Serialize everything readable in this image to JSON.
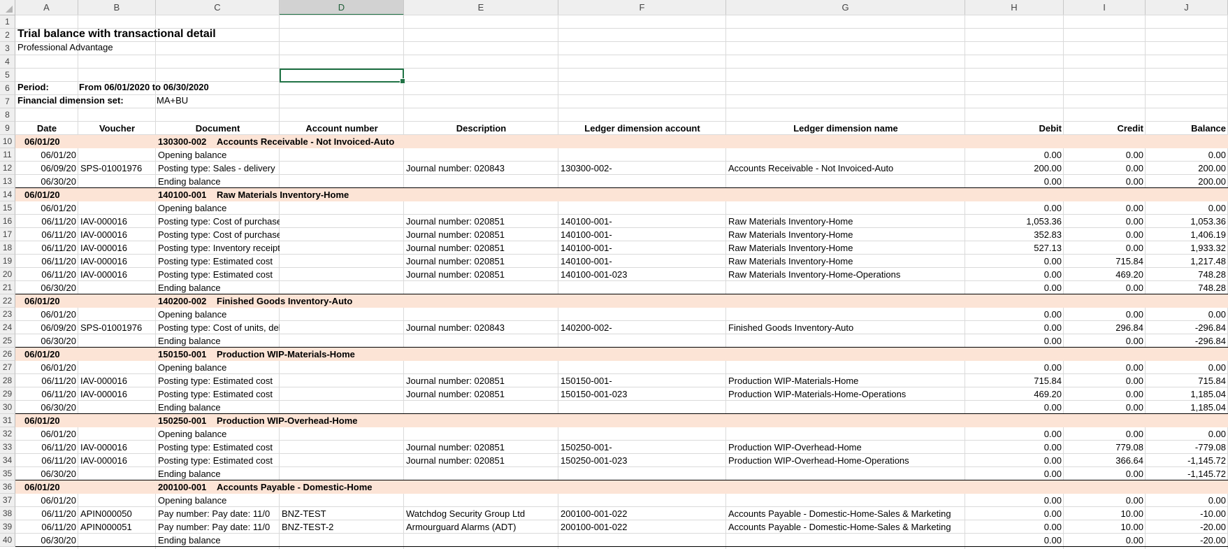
{
  "columns": [
    "A",
    "B",
    "C",
    "D",
    "E",
    "F",
    "G",
    "H",
    "I",
    "J"
  ],
  "selected_column": "D",
  "selected_cell": "D5",
  "report": {
    "title": "Trial balance with transactional detail",
    "company": "Professional Advantage",
    "period_label": "Period:",
    "period_value": "From 06/01/2020 to 06/30/2020",
    "dimension_label": "Financial dimension set:",
    "dimension_value": "MA+BU"
  },
  "headers": [
    "Date",
    "Voucher",
    "Document",
    "Account number",
    "Description",
    "Ledger dimension account",
    "Ledger dimension name",
    "Debit",
    "Credit",
    "Balance"
  ],
  "table_rows": [
    {
      "row": 10,
      "type": "group",
      "date": "06/01/20",
      "account": "130300-002",
      "name": "Accounts Receivable - Not Invoiced-Auto"
    },
    {
      "row": 11,
      "type": "detail",
      "date": "06/01/20",
      "voucher": "",
      "document": "Opening balance",
      "account": "",
      "description": "",
      "ledger_account": "",
      "ledger_name": "",
      "debit": "0.00",
      "credit": "0.00",
      "balance": "0.00"
    },
    {
      "row": 12,
      "type": "detail",
      "date": "06/09/20",
      "voucher": "SPS-01001976",
      "document": "Posting type: Sales - delivery",
      "account": "",
      "description": "Journal number: 020843",
      "ledger_account": "130300-002-",
      "ledger_name": "Accounts Receivable - Not Invoiced-Auto",
      "debit": "200.00",
      "credit": "0.00",
      "balance": "200.00"
    },
    {
      "row": 13,
      "type": "detail",
      "date": "06/30/20",
      "voucher": "",
      "document": "Ending balance",
      "account": "",
      "description": "",
      "ledger_account": "",
      "ledger_name": "",
      "debit": "0.00",
      "credit": "0.00",
      "balance": "200.00"
    },
    {
      "row": 14,
      "type": "group",
      "date": "06/01/20",
      "account": "140100-001",
      "name": "Raw Materials Inventory-Home"
    },
    {
      "row": 15,
      "type": "detail",
      "date": "06/01/20",
      "voucher": "",
      "document": "Opening balance",
      "account": "",
      "description": "",
      "ledger_account": "",
      "ledger_name": "",
      "debit": "0.00",
      "credit": "0.00",
      "balance": "0.00"
    },
    {
      "row": 16,
      "type": "detail",
      "date": "06/11/20",
      "voucher": "IAV-000016",
      "document": "Posting type: Cost of purchase",
      "account": "",
      "description": "Journal number: 020851",
      "ledger_account": "140100-001-",
      "ledger_name": "Raw Materials Inventory-Home",
      "debit": "1,053.36",
      "credit": "0.00",
      "balance": "1,053.36"
    },
    {
      "row": 17,
      "type": "detail",
      "date": "06/11/20",
      "voucher": "IAV-000016",
      "document": "Posting type: Cost of purchase",
      "account": "",
      "description": "Journal number: 020851",
      "ledger_account": "140100-001-",
      "ledger_name": "Raw Materials Inventory-Home",
      "debit": "352.83",
      "credit": "0.00",
      "balance": "1,406.19"
    },
    {
      "row": 18,
      "type": "detail",
      "date": "06/11/20",
      "voucher": "IAV-000016",
      "document": "Posting type: Inventory receipt",
      "account": "",
      "description": "Journal number: 020851",
      "ledger_account": "140100-001-",
      "ledger_name": "Raw Materials Inventory-Home",
      "debit": "527.13",
      "credit": "0.00",
      "balance": "1,933.32"
    },
    {
      "row": 19,
      "type": "detail",
      "date": "06/11/20",
      "voucher": "IAV-000016",
      "document": "Posting type: Estimated cost",
      "account": "",
      "description": "Journal number: 020851",
      "ledger_account": "140100-001-",
      "ledger_name": "Raw Materials Inventory-Home",
      "debit": "0.00",
      "credit": "715.84",
      "balance": "1,217.48"
    },
    {
      "row": 20,
      "type": "detail",
      "date": "06/11/20",
      "voucher": "IAV-000016",
      "document": "Posting type: Estimated cost",
      "account": "",
      "description": "Journal number: 020851",
      "ledger_account": "140100-001-023",
      "ledger_name": "Raw Materials Inventory-Home-Operations",
      "debit": "0.00",
      "credit": "469.20",
      "balance": "748.28"
    },
    {
      "row": 21,
      "type": "detail",
      "date": "06/30/20",
      "voucher": "",
      "document": "Ending balance",
      "account": "",
      "description": "",
      "ledger_account": "",
      "ledger_name": "",
      "debit": "0.00",
      "credit": "0.00",
      "balance": "748.28"
    },
    {
      "row": 22,
      "type": "group",
      "date": "06/01/20",
      "account": "140200-002",
      "name": "Finished Goods Inventory-Auto"
    },
    {
      "row": 23,
      "type": "detail",
      "date": "06/01/20",
      "voucher": "",
      "document": "Opening balance",
      "account": "",
      "description": "",
      "ledger_account": "",
      "ledger_name": "",
      "debit": "0.00",
      "credit": "0.00",
      "balance": "0.00"
    },
    {
      "row": 24,
      "type": "detail",
      "date": "06/09/20",
      "voucher": "SPS-01001976",
      "document": "Posting type: Cost of units, delivered",
      "account": "",
      "description": "Journal number: 020843",
      "ledger_account": "140200-002-",
      "ledger_name": "Finished Goods Inventory-Auto",
      "debit": "0.00",
      "credit": "296.84",
      "balance": "-296.84"
    },
    {
      "row": 25,
      "type": "detail",
      "date": "06/30/20",
      "voucher": "",
      "document": "Ending balance",
      "account": "",
      "description": "",
      "ledger_account": "",
      "ledger_name": "",
      "debit": "0.00",
      "credit": "0.00",
      "balance": "-296.84"
    },
    {
      "row": 26,
      "type": "group",
      "date": "06/01/20",
      "account": "150150-001",
      "name": "Production WIP-Materials-Home"
    },
    {
      "row": 27,
      "type": "detail",
      "date": "06/01/20",
      "voucher": "",
      "document": "Opening balance",
      "account": "",
      "description": "",
      "ledger_account": "",
      "ledger_name": "",
      "debit": "0.00",
      "credit": "0.00",
      "balance": "0.00"
    },
    {
      "row": 28,
      "type": "detail",
      "date": "06/11/20",
      "voucher": "IAV-000016",
      "document": "Posting type: Estimated cost",
      "account": "",
      "description": "Journal number: 020851",
      "ledger_account": "150150-001-",
      "ledger_name": "Production WIP-Materials-Home",
      "debit": "715.84",
      "credit": "0.00",
      "balance": "715.84"
    },
    {
      "row": 29,
      "type": "detail",
      "date": "06/11/20",
      "voucher": "IAV-000016",
      "document": "Posting type: Estimated cost",
      "account": "",
      "description": "Journal number: 020851",
      "ledger_account": "150150-001-023",
      "ledger_name": "Production WIP-Materials-Home-Operations",
      "debit": "469.20",
      "credit": "0.00",
      "balance": "1,185.04"
    },
    {
      "row": 30,
      "type": "detail",
      "date": "06/30/20",
      "voucher": "",
      "document": "Ending balance",
      "account": "",
      "description": "",
      "ledger_account": "",
      "ledger_name": "",
      "debit": "0.00",
      "credit": "0.00",
      "balance": "1,185.04"
    },
    {
      "row": 31,
      "type": "group",
      "date": "06/01/20",
      "account": "150250-001",
      "name": "Production WIP-Overhead-Home"
    },
    {
      "row": 32,
      "type": "detail",
      "date": "06/01/20",
      "voucher": "",
      "document": "Opening balance",
      "account": "",
      "description": "",
      "ledger_account": "",
      "ledger_name": "",
      "debit": "0.00",
      "credit": "0.00",
      "balance": "0.00"
    },
    {
      "row": 33,
      "type": "detail",
      "date": "06/11/20",
      "voucher": "IAV-000016",
      "document": "Posting type: Estimated cost",
      "account": "",
      "description": "Journal number: 020851",
      "ledger_account": "150250-001-",
      "ledger_name": "Production WIP-Overhead-Home",
      "debit": "0.00",
      "credit": "779.08",
      "balance": "-779.08"
    },
    {
      "row": 34,
      "type": "detail",
      "date": "06/11/20",
      "voucher": "IAV-000016",
      "document": "Posting type: Estimated cost",
      "account": "",
      "description": "Journal number: 020851",
      "ledger_account": "150250-001-023",
      "ledger_name": "Production WIP-Overhead-Home-Operations",
      "debit": "0.00",
      "credit": "366.64",
      "balance": "-1,145.72"
    },
    {
      "row": 35,
      "type": "detail",
      "date": "06/30/20",
      "voucher": "",
      "document": "Ending balance",
      "account": "",
      "description": "",
      "ledger_account": "",
      "ledger_name": "",
      "debit": "0.00",
      "credit": "0.00",
      "balance": "-1,145.72"
    },
    {
      "row": 36,
      "type": "group",
      "date": "06/01/20",
      "account": "200100-001",
      "name": "Accounts Payable - Domestic-Home"
    },
    {
      "row": 37,
      "type": "detail",
      "date": "06/01/20",
      "voucher": "",
      "document": "Opening balance",
      "account": "",
      "description": "",
      "ledger_account": "",
      "ledger_name": "",
      "debit": "0.00",
      "credit": "0.00",
      "balance": "0.00"
    },
    {
      "row": 38,
      "type": "detail",
      "date": "06/11/20",
      "voucher": "APIN000050",
      "document": "Pay number:    Pay date: 11/0",
      "account": "BNZ-TEST",
      "description": "Watchdog Security Group Ltd",
      "ledger_account": "200100-001-022",
      "ledger_name": "Accounts Payable - Domestic-Home-Sales & Marketing",
      "debit": "0.00",
      "credit": "10.00",
      "balance": "-10.00"
    },
    {
      "row": 39,
      "type": "detail",
      "date": "06/11/20",
      "voucher": "APIN000051",
      "document": "Pay number:    Pay date: 11/0",
      "account": "BNZ-TEST-2",
      "description": "Armourguard Alarms (ADT)",
      "ledger_account": "200100-001-022",
      "ledger_name": "Accounts Payable - Domestic-Home-Sales & Marketing",
      "debit": "0.00",
      "credit": "10.00",
      "balance": "-20.00"
    },
    {
      "row": 40,
      "type": "detail",
      "date": "06/30/20",
      "voucher": "",
      "document": "Ending balance",
      "account": "",
      "description": "",
      "ledger_account": "",
      "ledger_name": "",
      "debit": "0.00",
      "credit": "0.00",
      "balance": "-20.00"
    }
  ]
}
